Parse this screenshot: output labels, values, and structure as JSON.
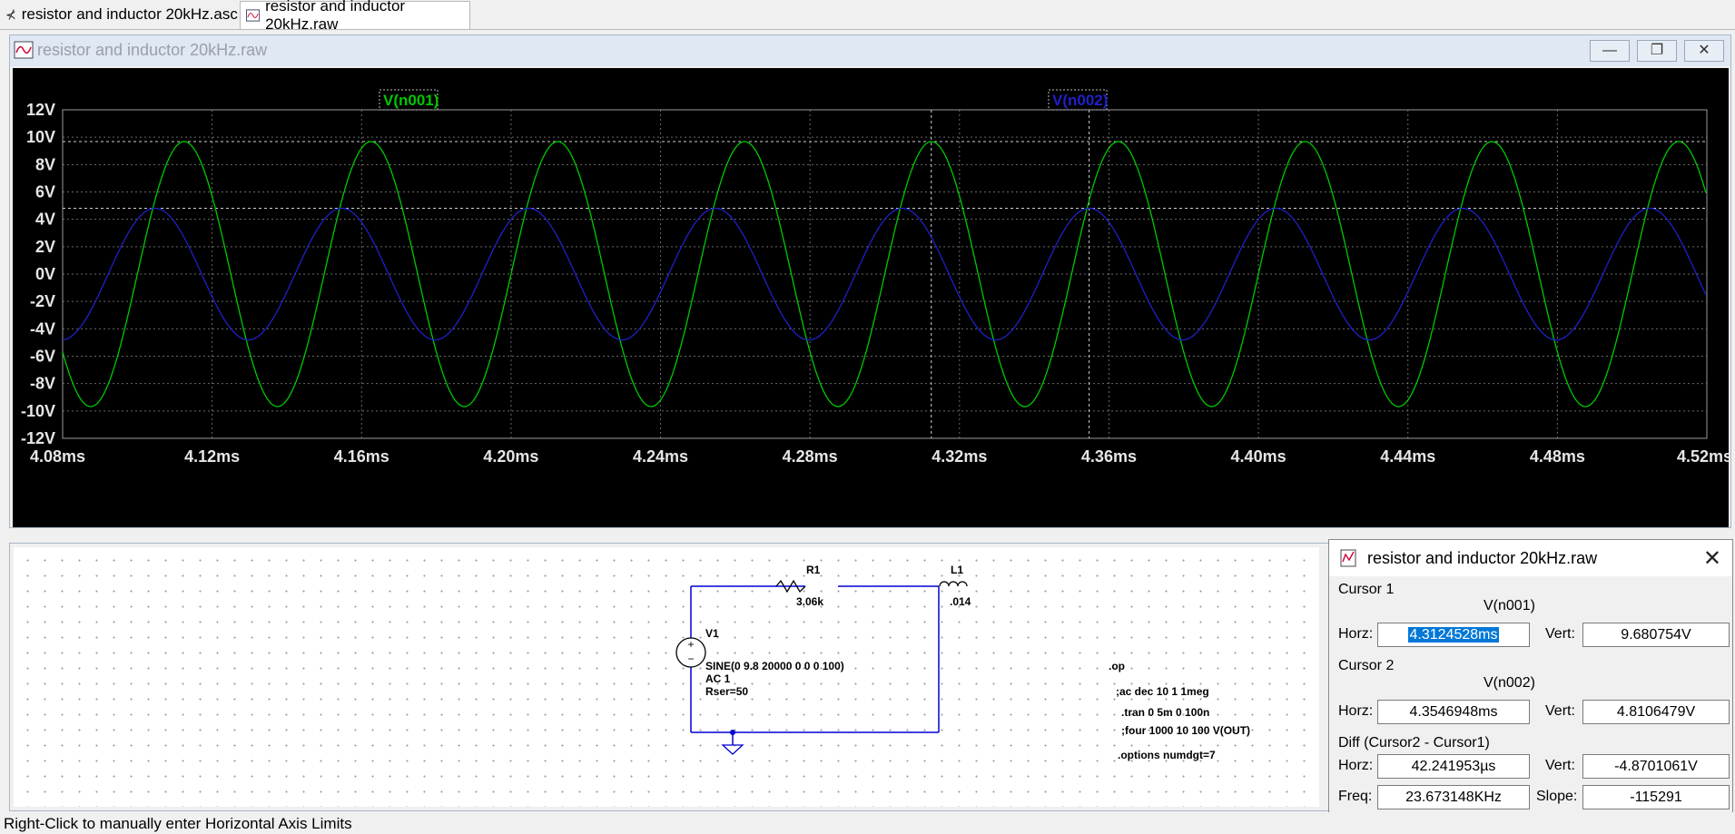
{
  "tabs": [
    {
      "label": "resistor and inductor 20kHz.asc",
      "icon": "schematic-icon"
    },
    {
      "label": "resistor and inductor 20kHz.raw",
      "icon": "waveform-icon"
    }
  ],
  "window": {
    "title": "resistor and inductor 20kHz.raw",
    "buttons": {
      "minimize": "—",
      "restore": "❐",
      "close": "✕"
    }
  },
  "colors": {
    "background": "#000000",
    "grid": "#6a6a6a",
    "frame": "#9a9a9a",
    "v_n001": "#00c800",
    "v_n002": "#2020c8"
  },
  "chart_data": {
    "type": "line",
    "x_unit": "ms",
    "xlim": [
      4.08,
      4.52
    ],
    "ylim": [
      -12,
      12
    ],
    "x_ticks": [
      "4.08ms",
      "4.12ms",
      "4.16ms",
      "4.20ms",
      "4.24ms",
      "4.28ms",
      "4.32ms",
      "4.36ms",
      "4.40ms",
      "4.44ms",
      "4.48ms",
      "4.52ms"
    ],
    "y_ticks": [
      "12V",
      "10V",
      "8V",
      "6V",
      "4V",
      "2V",
      "0V",
      "-2V",
      "-4V",
      "-6V",
      "-8V",
      "-10V",
      "-12V"
    ],
    "grid": true,
    "series": [
      {
        "name": "V(n001)",
        "amplitude": 9.68,
        "frequency_khz": 20,
        "peak_time_ms": 4.3125
      },
      {
        "name": "V(n002)",
        "amplitude": 4.81,
        "frequency_khz": 20,
        "peak_time_ms": 4.3547
      }
    ],
    "cursors": [
      {
        "x_ms": 4.3124528,
        "y": 9.680754
      },
      {
        "x_ms": 4.3546948,
        "y": 4.8106479
      }
    ]
  },
  "schematic": {
    "r1_name": "R1",
    "r1_value": "3.06k",
    "l1_name": "L1",
    "l1_value": ".014",
    "v1_name": "V1",
    "v1_line1": "SINE(0 9.8 20000 0 0 0 100)",
    "v1_line2": "AC 1",
    "v1_line3": "Rser=50",
    "directives": [
      ".op",
      ";ac dec 10 1 1meg",
      ".tran 0 5m 0 100n",
      ";four 1000 10 100 V(OUT)",
      ".options numdgt=7"
    ]
  },
  "cursor_dialog": {
    "title": "resistor and inductor 20kHz.raw",
    "cursor1": {
      "header": "Cursor 1",
      "trace": "V(n001)",
      "horz_label": "Horz:",
      "horz": "4.3124528ms",
      "vert_label": "Vert:",
      "vert": "9.680754V"
    },
    "cursor2": {
      "header": "Cursor 2",
      "trace": "V(n002)",
      "horz_label": "Horz:",
      "horz": "4.3546948ms",
      "vert_label": "Vert:",
      "vert": "4.8106479V"
    },
    "diff": {
      "header": "Diff (Cursor2 - Cursor1)",
      "horz_label": "Horz:",
      "horz": "42.241953µs",
      "vert_label": "Vert:",
      "vert": "-4.8701061V",
      "freq_label": "Freq:",
      "freq": "23.673148KHz",
      "slope_label": "Slope:",
      "slope": "-115291"
    }
  },
  "status_bar": "Right-Click to manually enter Horizontal Axis Limits"
}
